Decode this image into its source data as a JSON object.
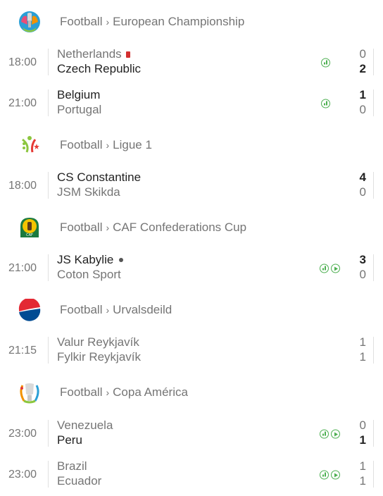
{
  "separator": "›",
  "leagues": [
    {
      "sport": "Football",
      "name": "European Championship",
      "logo_icon": "euro-2020-logo",
      "matches": [
        {
          "time": "18:00",
          "home": "Netherlands",
          "away": "Czech Republic",
          "home_score": "0",
          "away_score": "2",
          "winner": "away",
          "home_badge": "red-card",
          "icons": [
            "stats"
          ]
        },
        {
          "time": "21:00",
          "home": "Belgium",
          "away": "Portugal",
          "home_score": "1",
          "away_score": "0",
          "winner": "home",
          "icons": [
            "stats"
          ]
        }
      ]
    },
    {
      "sport": "Football",
      "name": "Ligue 1",
      "logo_icon": "algeria-ligue1-logo",
      "matches": [
        {
          "time": "18:00",
          "home": "CS Constantine",
          "away": "JSM Skikda",
          "home_score": "4",
          "away_score": "0",
          "winner": "home",
          "icons": []
        }
      ]
    },
    {
      "sport": "Football",
      "name": "CAF Confederations Cup",
      "logo_icon": "caf-logo",
      "matches": [
        {
          "time": "21:00",
          "home": "JS Kabylie",
          "away": "Coton Sport",
          "home_score": "3",
          "away_score": "0",
          "winner": "home",
          "home_badge": "dot",
          "icons": [
            "stats",
            "play"
          ]
        }
      ]
    },
    {
      "sport": "Football",
      "name": "Urvalsdeild",
      "logo_icon": "pepsi-logo",
      "matches": [
        {
          "time": "21:15",
          "home": "Valur Reykjavík",
          "away": "Fylkir Reykjavík",
          "home_score": "1",
          "away_score": "1",
          "winner": "none",
          "icons": []
        }
      ]
    },
    {
      "sport": "Football",
      "name": "Copa América",
      "logo_icon": "copa-america-logo",
      "matches": [
        {
          "time": "23:00",
          "home": "Venezuela",
          "away": "Peru",
          "home_score": "0",
          "away_score": "1",
          "winner": "away",
          "icons": [
            "stats",
            "play"
          ]
        },
        {
          "time": "23:00",
          "home": "Brazil",
          "away": "Ecuador",
          "home_score": "1",
          "away_score": "1",
          "winner": "none",
          "icons": [
            "stats",
            "play"
          ]
        }
      ]
    }
  ]
}
